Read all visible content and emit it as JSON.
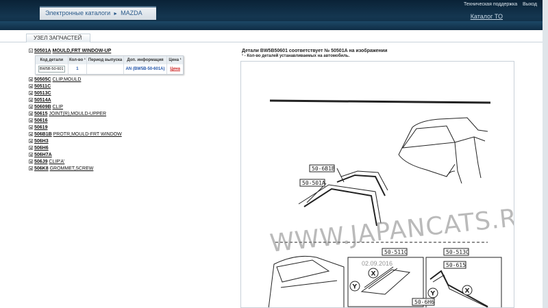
{
  "header": {
    "breadcrumb": [
      "Электронные каталоги",
      "MAZDA"
    ],
    "support_link": "Техническая поддержка",
    "logout_link": "Выход",
    "catalog_link": "Каталог ТО"
  },
  "section": {
    "tab_label": "УЗЕЛ ЗАПЧАСТЕЙ"
  },
  "parts": {
    "expanded": {
      "code": "50501A",
      "name": "MOULD,FRT WINDOW-UP"
    },
    "table": {
      "headers": [
        "Код детали",
        "Кол-во ¹",
        "Период выпуска",
        "Доп. информация",
        "Цена ¹"
      ],
      "row": {
        "code": "BW5B-50-601",
        "qty": "1",
        "period": "",
        "info": "AN (BW5B-50-601A)",
        "price": "Цена"
      }
    },
    "items": [
      {
        "code": "50505C",
        "name": "CLIP,MOULD"
      },
      {
        "code": "50511C",
        "name": ""
      },
      {
        "code": "50513C",
        "name": ""
      },
      {
        "code": "50514A",
        "name": ""
      },
      {
        "code": "50609B",
        "name": "CLIP"
      },
      {
        "code": "50615",
        "name": "JOINT(R),MOULD-UPPER"
      },
      {
        "code": "50616",
        "name": ""
      },
      {
        "code": "50619",
        "name": ""
      },
      {
        "code": "506B1B",
        "name": "PROTR,MOULD-FRT WINDOW"
      },
      {
        "code": "506H3",
        "name": ""
      },
      {
        "code": "506H6",
        "name": ""
      },
      {
        "code": "506H7A",
        "name": ""
      },
      {
        "code": "506J9",
        "name": "CLIP'A'"
      },
      {
        "code": "506K8",
        "name": "GROMMET,SCREW"
      }
    ]
  },
  "info": {
    "title": "Детали BW5B50601 соответствует № 50501A на изображении",
    "note": "¹ - Кол-во деталей устанавливаемых на автомобиль."
  },
  "diagram": {
    "labels": [
      "50-6B1B",
      "50-501A",
      "50-511C",
      "50-513C",
      "50-615",
      "50-6H6"
    ],
    "callouts": [
      "Y",
      "X",
      "Y",
      "X"
    ],
    "watermark": "WWW.JAPANCATS.RU",
    "watermark_date": "02.09.2016"
  }
}
